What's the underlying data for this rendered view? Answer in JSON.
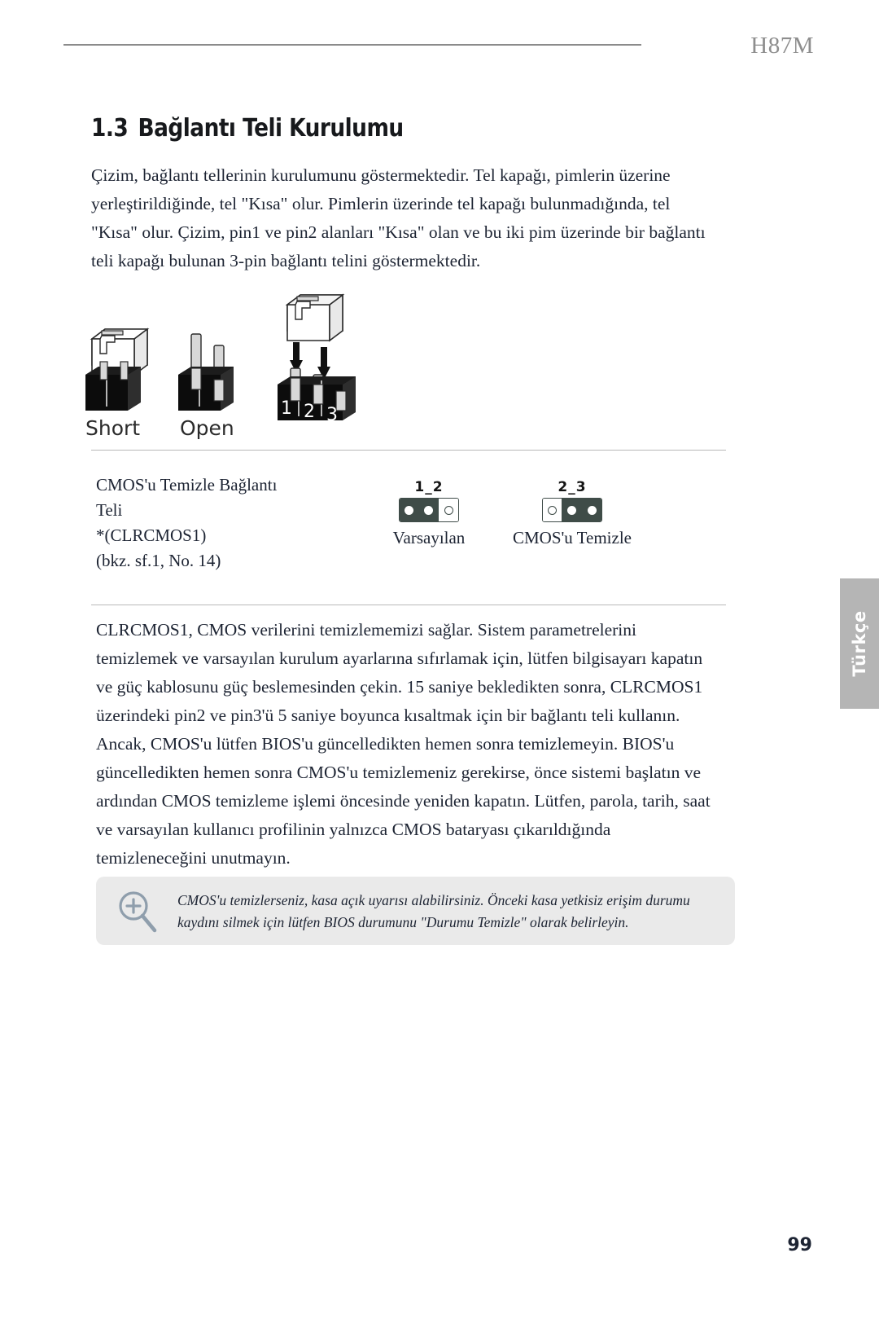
{
  "header": {
    "model": "H87M"
  },
  "heading": {
    "number": "1.3",
    "title": "Bağlantı Teli Kurulumu"
  },
  "intro_paragraph": "Çizim, bağlantı tellerinin kurulumunu göstermektedir. Tel kapağı, pimlerin üzerine yerleştirildiğinde, tel \"Kısa\" olur. Pimlerin üzerinde tel kapağı bulunmadığında, tel \"Kısa\" olur. Çizim, pin1 ve pin2 alanları \"Kısa\" olan ve bu iki pim üzerinde bir bağlantı teli kapağı bulunan 3-pin bağlantı telini göstermektedir.",
  "figure": {
    "short_label": "Short",
    "open_label": "Open",
    "pin_numbers": [
      "1",
      "2",
      "3"
    ]
  },
  "jumper_row": {
    "label_lines": [
      "CMOS'u Temizle Bağlantı",
      "Teli",
      "*(CLRCMOS1)",
      "(bkz. sf.1, No. 14)"
    ],
    "label_full": "CMOS'u Temizle Bağlantı Teli *(CLRCMOS1) (bkz. sf.1, No. 14)",
    "settings": [
      {
        "pins_label": "1_2",
        "caption": "Varsayılan",
        "cells": [
          "filled",
          "filled",
          "empty"
        ]
      },
      {
        "pins_label": "2_3",
        "caption": "CMOS'u Temizle",
        "cells": [
          "empty",
          "filled",
          "filled"
        ]
      }
    ]
  },
  "detail_paragraph": "CLRCMOS1, CMOS verilerini temizlememizi sağlar. Sistem parametrelerini temizlemek ve varsayılan kurulum ayarlarına sıfırlamak için, lütfen bilgisayarı kapatın ve güç kablosunu güç beslemesinden çekin. 15 saniye bekledikten sonra, CLRCMOS1 üzerindeki pin2 ve pin3'ü 5 saniye boyunca kısaltmak için bir bağlantı teli kullanın. Ancak, CMOS'u lütfen BIOS'u güncelledikten hemen sonra temizlemeyin.  BIOS'u güncelledikten hemen sonra CMOS'u temizlemeniz gerekirse, önce sistemi başlatın ve ardından CMOS temizleme işlemi öncesinde yeniden kapatın.  Lütfen, parola, tarih, saat ve varsayılan kullanıcı profilinin yalnızca CMOS bataryası çıkarıldığında temizleneceğini unutmayın.",
  "note": {
    "icon": "magnifier-plus-icon",
    "text": "CMOS'u temizlerseniz, kasa açık uyarısı alabilirsiniz. Önceki kasa yetkisiz erişim durumu kaydını silmek için lütfen BIOS durumunu \"Durumu Temizle\" olarak belirleyin."
  },
  "side_tab": {
    "label": "Türkçe"
  },
  "page_number": "99",
  "colors": {
    "text": "#1d2433",
    "header_gray": "#8e8e8e",
    "rule_gray": "#b9b9b9",
    "pin_dark": "#3f4c48",
    "note_bg": "#eaeaea",
    "side_tab_bg": "#b5b5b5",
    "note_icon": "#8f9eac"
  }
}
